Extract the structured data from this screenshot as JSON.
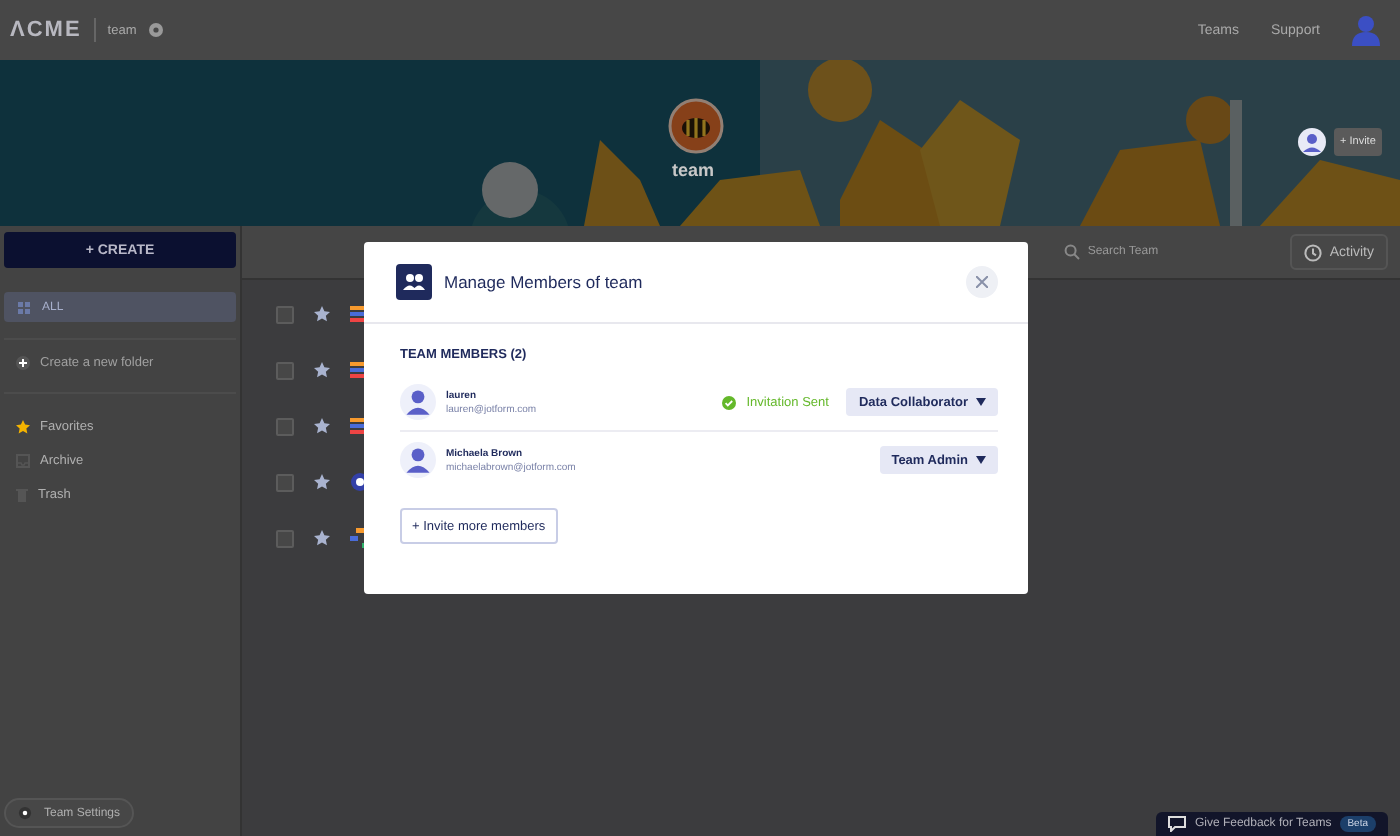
{
  "header": {
    "logo": "ΛCME",
    "team_name": "team",
    "nav": [
      "Teams",
      "Support"
    ]
  },
  "banner": {
    "title": "team",
    "invite": "+ Invite"
  },
  "sidebar": {
    "create": "+ CREATE",
    "all": {
      "label": "ALL",
      "selected": true
    },
    "create_folder": "Create a new folder",
    "items": [
      {
        "label": "Favorites",
        "kind": "star"
      },
      {
        "label": "Archive",
        "kind": "archive"
      },
      {
        "label": "Trash",
        "kind": "trash"
      }
    ],
    "team_settings": "Team Settings"
  },
  "toolbar": {
    "search": {
      "placeholder": "Search Team"
    },
    "activity": "Activity"
  },
  "rows": [
    {
      "kind": "form",
      "checked": false
    },
    {
      "kind": "form",
      "checked": false
    },
    {
      "kind": "form",
      "checked": false
    },
    {
      "kind": "app",
      "checked": false
    },
    {
      "kind": "flow",
      "checked": false
    }
  ],
  "modal": {
    "title": "Manage Members of team",
    "section": "TEAM MEMBERS (2)",
    "members": [
      {
        "name": "lauren",
        "email": "lauren@jotform.com",
        "status": "Invitation Sent",
        "role": "Data Collaborator"
      },
      {
        "name": "Michaela Brown",
        "email": "michaelabrown@jotform.com",
        "role": "Team Admin"
      }
    ],
    "invite": "+ Invite more members"
  },
  "feedback": {
    "label": "Give Feedback for Teams",
    "badge": "Beta"
  }
}
